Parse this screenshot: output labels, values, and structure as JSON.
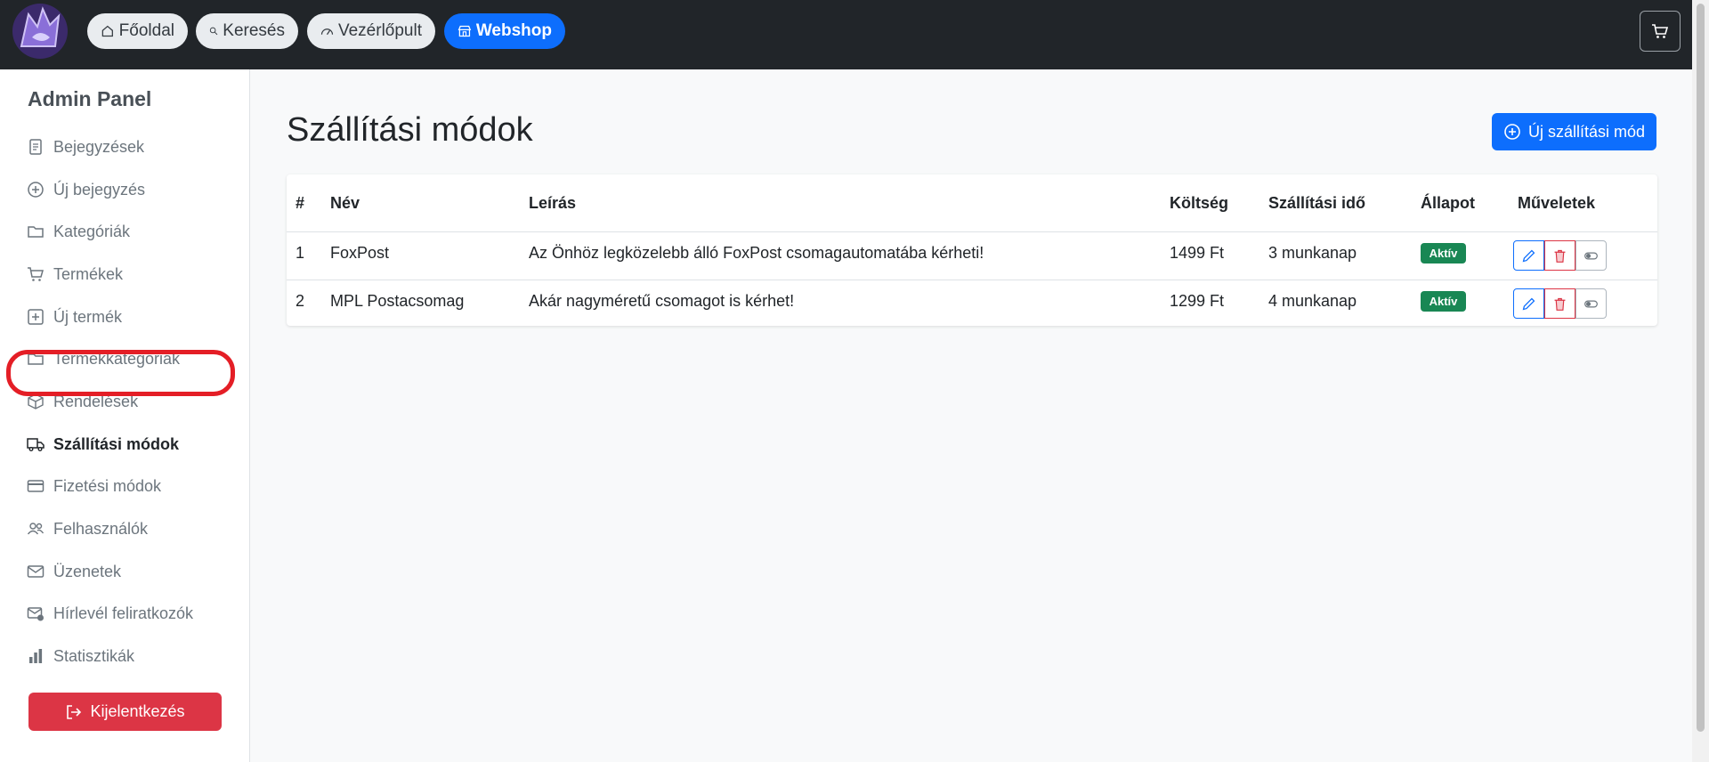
{
  "nav": {
    "items": [
      {
        "label": "Főoldal",
        "icon": "home-icon"
      },
      {
        "label": "Keresés",
        "icon": "search-icon"
      },
      {
        "label": "Vezérlőpult",
        "icon": "dashboard-icon"
      },
      {
        "label": "Webshop",
        "icon": "shop-icon"
      }
    ],
    "cart_icon": "cart-icon"
  },
  "sidebar": {
    "title": "Admin Panel",
    "items": [
      {
        "label": "Bejegyzések",
        "icon": "document-icon"
      },
      {
        "label": "Új bejegyzés",
        "icon": "plus-circle-icon"
      },
      {
        "label": "Kategóriák",
        "icon": "folder-icon"
      },
      {
        "label": "Termékek",
        "icon": "cart-icon"
      },
      {
        "label": "Új termék",
        "icon": "plus-square-icon"
      },
      {
        "label": "Termékkategóriák",
        "icon": "folder-icon"
      },
      {
        "label": "Rendelések",
        "icon": "box-icon"
      },
      {
        "label": "Szállítási módok",
        "icon": "truck-icon",
        "active": true
      },
      {
        "label": "Fizetési módok",
        "icon": "credit-card-icon"
      },
      {
        "label": "Felhasználók",
        "icon": "people-icon"
      },
      {
        "label": "Üzenetek",
        "icon": "envelope-icon"
      },
      {
        "label": "Hírlevél feliratkozók",
        "icon": "envelope-check-icon"
      },
      {
        "label": "Statisztikák",
        "icon": "bar-chart-icon"
      }
    ],
    "logout_label": "Kijelentkezés"
  },
  "main": {
    "title": "Szállítási módok",
    "new_button": "Új szállítási mód",
    "table": {
      "headers": [
        "#",
        "Név",
        "Leírás",
        "Költség",
        "Szállítási idő",
        "Állapot",
        "Műveletek"
      ],
      "rows": [
        {
          "id": "1",
          "name": "FoxPost",
          "description": "Az Önhöz legközelebb álló FoxPost csomagautomatába kérheti!",
          "cost": "1499 Ft",
          "time": "3 munkanap",
          "status": "Aktív"
        },
        {
          "id": "2",
          "name": "MPL Postacsomag",
          "description": "Akár nagyméretű csomagot is kérhet!",
          "cost": "1299 Ft",
          "time": "4 munkanap",
          "status": "Aktív"
        }
      ]
    }
  },
  "colors": {
    "topbar": "#212529",
    "primary": "#0d6efd",
    "danger": "#dc3545",
    "success": "#198754",
    "highlight": "#e41e26"
  }
}
